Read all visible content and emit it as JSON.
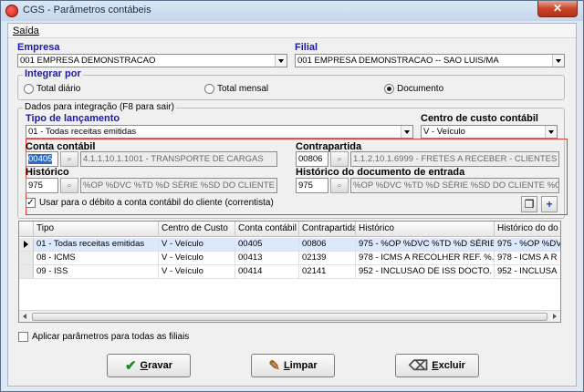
{
  "window": {
    "title": "CGS - Parâmetros contábeis",
    "close_glyph": "✕"
  },
  "menu": {
    "saida": "Saída"
  },
  "empresa": {
    "label": "Empresa",
    "value": "001 EMPRESA DEMONSTRACAO"
  },
  "filial": {
    "label": "Filial",
    "value": "001 EMPRESA DEMONSTRACAO -- SAO LUIS/MA"
  },
  "integrar_por": {
    "title": "Integrar por",
    "options": [
      "Total diário",
      "Total mensal",
      "Documento"
    ],
    "selected": "Documento"
  },
  "dados": {
    "title": "Dados para integração  (F8 para sair)",
    "tipo_label": "Tipo de lançamento",
    "tipo_value": "01 - Todas receitas emitidas",
    "centro_label": "Centro de custo contábil",
    "centro_value": "V - Veículo"
  },
  "conta": {
    "label": "Conta contábil",
    "code": "00405",
    "desc": "4.1.1.10.1.1001 - TRANSPORTE DE CARGAS"
  },
  "contrapartida": {
    "label": "Contrapartida",
    "code": "00806",
    "desc": "1.1.2.10.1.6999 - FRETES A RECEBER - CLIENTES"
  },
  "historico": {
    "label": "Histórico",
    "code": "975",
    "desc": "%OP %DVC %TD %D SÉRIE %SD DO CLIENTE %CF"
  },
  "historico_doc": {
    "label": "Histórico do documento de entrada",
    "code": "975",
    "desc": "%OP %DVC %TD %D SÉRIE %SD DO CLIENTE %CF"
  },
  "usar_debito": {
    "label": "Usar para o débito a conta contábil do cliente (correntista)",
    "checked": true,
    "mark": "✓"
  },
  "icons": {
    "binoculars_glyph": "⌕",
    "copy_glyph": "❐",
    "add_glyph": "+"
  },
  "grid": {
    "columns": [
      "Tipo",
      "Centro de Custo",
      "Conta contábil",
      "Contrapartida",
      "Histórico",
      "Histórico do do"
    ],
    "rows": [
      [
        "01 - Todas receitas emitidas",
        "V - Veículo",
        "00405",
        "00806",
        "975 - %OP %DVC %TD %D SÉRIE ...",
        "975 - %OP %DV"
      ],
      [
        "08 - ICMS",
        "V - Veículo",
        "00413",
        "02139",
        "978 - ICMS A RECOLHER REF. %...",
        "978 - ICMS A R"
      ],
      [
        "09 - ISS",
        "V - Veículo",
        "00414",
        "02141",
        "952 - INCLUSAO DE ISS DOCTO. ...",
        "952 - INCLUSA"
      ]
    ]
  },
  "aplicar": {
    "label": "Aplicar parâmetros para todas as filiais",
    "checked": false
  },
  "buttons": {
    "gravar": {
      "first": "G",
      "rest": "ravar",
      "icon": "✔"
    },
    "limpar": {
      "first": "L",
      "rest": "impar",
      "icon": "✎"
    },
    "excluir": {
      "first": "E",
      "rest": "xcluir",
      "icon": "⌫"
    }
  }
}
